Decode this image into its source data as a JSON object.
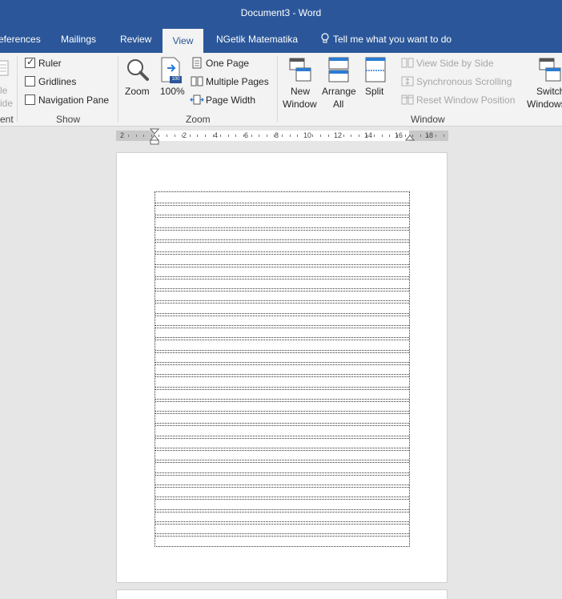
{
  "window": {
    "title": "Document3  -  Word"
  },
  "tabs": [
    {
      "label": "eferences"
    },
    {
      "label": "Mailings"
    },
    {
      "label": "Review"
    },
    {
      "label": "View"
    },
    {
      "label": "NGetik Matematika"
    }
  ],
  "tell_me": {
    "placeholder": "Tell me what you want to do"
  },
  "ribbon": {
    "clipped_left": {
      "line1": "le",
      "line2": "ide",
      "group": "ent"
    },
    "show": {
      "group_label": "Show",
      "ruler": {
        "label": "Ruler",
        "checked": true
      },
      "gridlines": {
        "label": "Gridlines",
        "checked": false
      },
      "navigation_pane": {
        "label": "Navigation Pane",
        "checked": false
      }
    },
    "zoom": {
      "group_label": "Zoom",
      "zoom_label": "Zoom",
      "hundred_label": "100%",
      "hundred_badge": "100",
      "one_page": "One Page",
      "multiple_pages": "Multiple Pages",
      "page_width": "Page Width"
    },
    "window": {
      "group_label": "Window",
      "new_window": {
        "line1": "New",
        "line2": "Window"
      },
      "arrange_all": {
        "line1": "Arrange",
        "line2": "All"
      },
      "split": "Split",
      "view_side_by_side": "View Side by Side",
      "synchronous_scrolling": "Synchronous Scrolling",
      "reset_window_position": "Reset Window Position",
      "switch_windows": {
        "line1": "Switch",
        "line2": "Windows"
      }
    }
  },
  "ruler": {
    "labels": [
      "2",
      "2",
      "4",
      "6",
      "8",
      "10",
      "12",
      "14",
      "16",
      "18"
    ]
  },
  "colors": {
    "brand": "#2b579a",
    "ribbon_bg": "#f3f3f3",
    "canvas_bg": "#e6e6e6"
  }
}
